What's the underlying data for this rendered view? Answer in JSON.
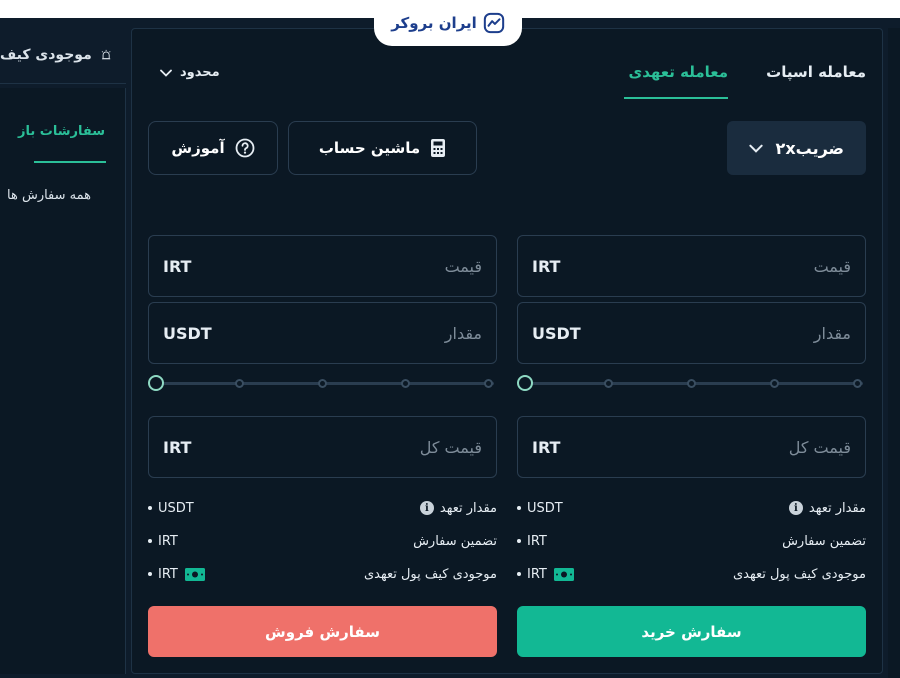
{
  "logo": {
    "text": "ایران بروکر"
  },
  "left": {
    "wallet_label": "موجودی کیف",
    "open_orders": "سفارشات باز",
    "all_orders": "همه سفارش ها"
  },
  "tabs": {
    "spot": "معامله اسپات",
    "futures": "معامله تعهدی",
    "active": "futures"
  },
  "order_type": {
    "selected": "محدود"
  },
  "leverage": {
    "label": "ضریب۲x"
  },
  "tools": {
    "calculator": "ماشین حساب",
    "learn": "آموزش"
  },
  "buy": {
    "price": {
      "unit": "IRT",
      "placeholder": "قیمت"
    },
    "amount": {
      "unit": "USDT",
      "placeholder": "مقدار"
    },
    "total": {
      "unit": "IRT",
      "placeholder": "قیمت کل"
    },
    "slider_percent": 0,
    "info": [
      {
        "label": "مقدار تعهد",
        "unit": "USDT"
      },
      {
        "label": "تضمین سفارش",
        "unit": "IRT"
      },
      {
        "label": "موجودی کیف پول تعهدی",
        "unit": "IRT"
      }
    ],
    "button": "سفارش خرید"
  },
  "sell": {
    "price": {
      "unit": "IRT",
      "placeholder": "قیمت"
    },
    "amount": {
      "unit": "USDT",
      "placeholder": "مقدار"
    },
    "total": {
      "unit": "IRT",
      "placeholder": "قیمت کل"
    },
    "slider_percent": 0,
    "info": [
      {
        "label": "مقدار تعهد",
        "unit": "USDT"
      },
      {
        "label": "تضمین سفارش",
        "unit": "IRT"
      },
      {
        "label": "موجودی کیف پول تعهدی",
        "unit": "IRT"
      }
    ],
    "button": "سفارش فروش"
  },
  "colors": {
    "accent": "#2bbf98",
    "buy": "#12b894",
    "sell": "#ef716a",
    "background": "#0b1824"
  }
}
